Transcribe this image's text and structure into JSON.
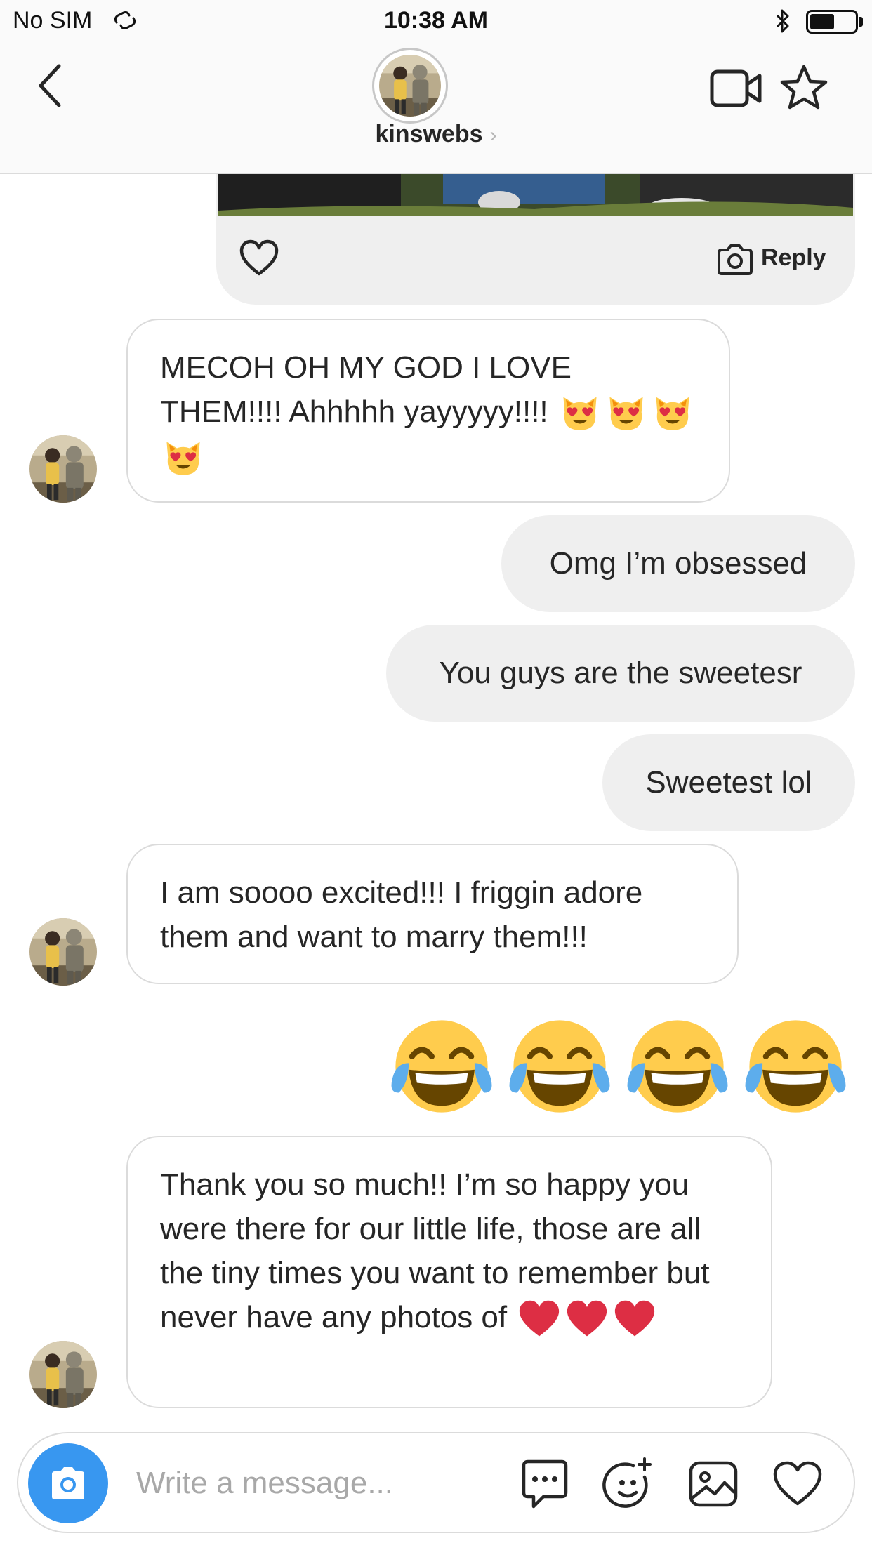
{
  "status_bar": {
    "carrier": "No SIM",
    "time": "10:38 AM",
    "battery_level": 0.55
  },
  "header": {
    "username": "kinswebs",
    "username_chevron": "›",
    "icons": [
      "back-chevron-icon",
      "video-camera-icon",
      "star-icon"
    ]
  },
  "shared_post": {
    "reply_label": "Reply",
    "icons": [
      "heart-icon",
      "camera-icon"
    ]
  },
  "messages": [
    {
      "from": "them",
      "text": "MECOH OH MY GOD I LOVE THEM!!!! Ahhhhh yayyyyy!!!!",
      "emojis": [
        "heart-eyes-cat",
        "heart-eyes-cat",
        "heart-eyes-cat",
        "heart-eyes-cat"
      ]
    },
    {
      "from": "me",
      "text": "Omg I’m obsessed"
    },
    {
      "from": "me",
      "text": "You guys are the sweetesr"
    },
    {
      "from": "me",
      "text": "Sweetest lol"
    },
    {
      "from": "them",
      "text": "I am soooo excited!!! I friggin adore them and want to marry them!!!"
    },
    {
      "from": "me",
      "emojis": [
        "tears-of-joy",
        "tears-of-joy",
        "tears-of-joy",
        "tears-of-joy"
      ]
    },
    {
      "from": "them",
      "text": "Thank you so much!! I’m so happy you were there for our little life, those are all the tiny times you want to remember but never have any photos of",
      "emojis": [
        "red-heart",
        "red-heart",
        "red-heart"
      ]
    }
  ],
  "composer": {
    "placeholder": "Write a message...",
    "icons": [
      "camera-icon",
      "chat-bubble-icon",
      "sticker-icon",
      "gallery-icon",
      "heart-icon"
    ]
  },
  "colors": {
    "accent": "#3897f0",
    "bubble_out": "#efefef",
    "border": "#dbdbdb",
    "heart_red": "#dd2e44",
    "emoji_yellow": "#ffcc4d"
  }
}
